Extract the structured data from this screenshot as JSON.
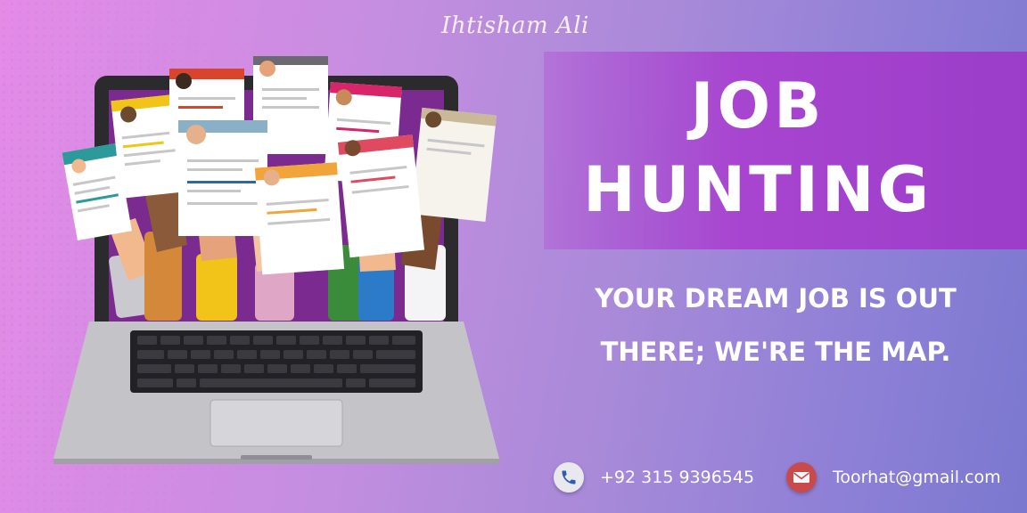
{
  "brand": {
    "signature": "Ihtisham Ali"
  },
  "headline": {
    "line1": "JOB",
    "line2": "HUNTING"
  },
  "tagline": {
    "line1": "YOUR DREAM JOB IS OUT",
    "line2": "THERE; WE'RE THE MAP."
  },
  "contact": {
    "phone": "+92 315 9396545",
    "phone_icon": "phone-icon",
    "email": "Toorhat@gmail.com",
    "email_icon": "mail-icon"
  },
  "illustration": {
    "subject": "laptop-with-raised-hands-holding-resumes",
    "accent_colors": [
      "#2c9a9a",
      "#f2c318",
      "#d9442c",
      "#8ab0c8",
      "#f0a43a",
      "#d8256a",
      "#e04a60",
      "#c9b89a",
      "#6a6a70"
    ]
  },
  "colors": {
    "background_start": "#e48be6",
    "background_end": "#7b78cf",
    "title_band": "#a845d0",
    "text": "#ffffff"
  }
}
